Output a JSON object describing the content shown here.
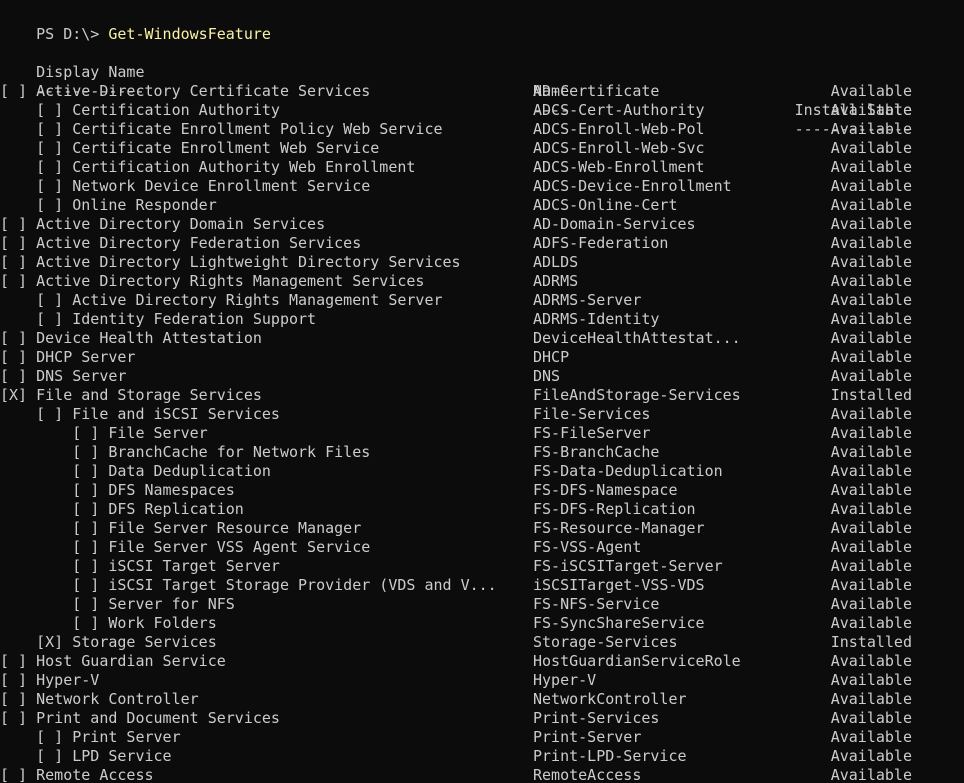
{
  "prompt": {
    "path": "PS D:\\> ",
    "command": "Get-WindowsFeature"
  },
  "headers": {
    "display_name": "Display Name",
    "name": "Name",
    "install_state": "Install State",
    "display_underline": "------------",
    "name_underline": "----",
    "state_underline": "-------------"
  },
  "colors": {
    "background": "#0c0c0c",
    "text": "#cccccc",
    "command": "#f9f1a5"
  },
  "rows": [
    {
      "display": "[ ] Active Directory Certificate Services",
      "name": "AD-Certificate",
      "state": "Available"
    },
    {
      "display": "    [ ] Certification Authority",
      "name": "ADCS-Cert-Authority",
      "state": "Available"
    },
    {
      "display": "    [ ] Certificate Enrollment Policy Web Service",
      "name": "ADCS-Enroll-Web-Pol",
      "state": "Available"
    },
    {
      "display": "    [ ] Certificate Enrollment Web Service",
      "name": "ADCS-Enroll-Web-Svc",
      "state": "Available"
    },
    {
      "display": "    [ ] Certification Authority Web Enrollment",
      "name": "ADCS-Web-Enrollment",
      "state": "Available"
    },
    {
      "display": "    [ ] Network Device Enrollment Service",
      "name": "ADCS-Device-Enrollment",
      "state": "Available"
    },
    {
      "display": "    [ ] Online Responder",
      "name": "ADCS-Online-Cert",
      "state": "Available"
    },
    {
      "display": "[ ] Active Directory Domain Services",
      "name": "AD-Domain-Services",
      "state": "Available"
    },
    {
      "display": "[ ] Active Directory Federation Services",
      "name": "ADFS-Federation",
      "state": "Available"
    },
    {
      "display": "[ ] Active Directory Lightweight Directory Services",
      "name": "ADLDS",
      "state": "Available"
    },
    {
      "display": "[ ] Active Directory Rights Management Services",
      "name": "ADRMS",
      "state": "Available"
    },
    {
      "display": "    [ ] Active Directory Rights Management Server",
      "name": "ADRMS-Server",
      "state": "Available"
    },
    {
      "display": "    [ ] Identity Federation Support",
      "name": "ADRMS-Identity",
      "state": "Available"
    },
    {
      "display": "[ ] Device Health Attestation",
      "name": "DeviceHealthAttestat...",
      "state": "Available"
    },
    {
      "display": "[ ] DHCP Server",
      "name": "DHCP",
      "state": "Available"
    },
    {
      "display": "[ ] DNS Server",
      "name": "DNS",
      "state": "Available"
    },
    {
      "display": "[X] File and Storage Services",
      "name": "FileAndStorage-Services",
      "state": "Installed"
    },
    {
      "display": "    [ ] File and iSCSI Services",
      "name": "File-Services",
      "state": "Available"
    },
    {
      "display": "        [ ] File Server",
      "name": "FS-FileServer",
      "state": "Available"
    },
    {
      "display": "        [ ] BranchCache for Network Files",
      "name": "FS-BranchCache",
      "state": "Available"
    },
    {
      "display": "        [ ] Data Deduplication",
      "name": "FS-Data-Deduplication",
      "state": "Available"
    },
    {
      "display": "        [ ] DFS Namespaces",
      "name": "FS-DFS-Namespace",
      "state": "Available"
    },
    {
      "display": "        [ ] DFS Replication",
      "name": "FS-DFS-Replication",
      "state": "Available"
    },
    {
      "display": "        [ ] File Server Resource Manager",
      "name": "FS-Resource-Manager",
      "state": "Available"
    },
    {
      "display": "        [ ] File Server VSS Agent Service",
      "name": "FS-VSS-Agent",
      "state": "Available"
    },
    {
      "display": "        [ ] iSCSI Target Server",
      "name": "FS-iSCSITarget-Server",
      "state": "Available"
    },
    {
      "display": "        [ ] iSCSI Target Storage Provider (VDS and V...",
      "name": "iSCSITarget-VSS-VDS",
      "state": "Available"
    },
    {
      "display": "        [ ] Server for NFS",
      "name": "FS-NFS-Service",
      "state": "Available"
    },
    {
      "display": "        [ ] Work Folders",
      "name": "FS-SyncShareService",
      "state": "Available"
    },
    {
      "display": "    [X] Storage Services",
      "name": "Storage-Services",
      "state": "Installed"
    },
    {
      "display": "[ ] Host Guardian Service",
      "name": "HostGuardianServiceRole",
      "state": "Available"
    },
    {
      "display": "[ ] Hyper-V",
      "name": "Hyper-V",
      "state": "Available"
    },
    {
      "display": "[ ] Network Controller",
      "name": "NetworkController",
      "state": "Available"
    },
    {
      "display": "[ ] Print and Document Services",
      "name": "Print-Services",
      "state": "Available"
    },
    {
      "display": "    [ ] Print Server",
      "name": "Print-Server",
      "state": "Available"
    },
    {
      "display": "    [ ] LPD Service",
      "name": "Print-LPD-Service",
      "state": "Available"
    },
    {
      "display": "[ ] Remote Access",
      "name": "RemoteAccess",
      "state": "Available"
    }
  ]
}
